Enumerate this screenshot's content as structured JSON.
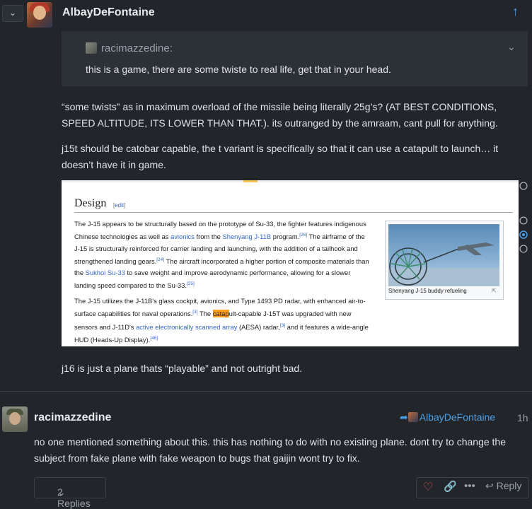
{
  "post1": {
    "username": "AlbayDeFontaine",
    "quote": {
      "username": "racimazzedine:",
      "text": "this is a game, there are some twiste to real life, get that in your head."
    },
    "para1": "“some twists” as in maximum overload of the missile being literally 25g’s? (AT BEST CONDITIONS, SPEED ALTITUDE, ITS LOWER THAN THAT.). its outranged by the amraam, cant pull for anything.",
    "para2": "j15t should be catobar capable, the t variant is specifically so that it can use a catapult to launch… it doesn’t have it in game.",
    "para3": "j16 is just a plane thats “playable” and not outright bad."
  },
  "wiki": {
    "heading": "Design",
    "edit_open": "[",
    "edit_label": "edit",
    "edit_close": "]",
    "caption": "Shenyang J-15 buddy refueling",
    "p1": {
      "a": "The J-15 appears to be structurally based on the prototype of Su-33, the fighter features indigenous Chinese technologies as well as ",
      "link1": "avionics",
      "b": " from the ",
      "link2": "Shenyang J-11B",
      "c": " program.",
      "ref1": "[26]",
      "d": " The airframe of the J-15 is structurally reinforced for carrier landing and launching, with the addition of a tailhook and strengthened landing gears.",
      "ref2": "[24]",
      "e": " The aircraft incorporated a higher portion of composite materials than the ",
      "link3": "Sukhoi Su-33",
      "f": " to save weight and improve aerodynamic performance, allowing for a slower landing speed compared to the Su-33.",
      "ref3": "[25]"
    },
    "p2": {
      "a": "The J-15 utilizes the J-11B's glass cockpit, avionics, and Type 1493 PD radar, with enhanced air-to-surface capabilities for naval operations.",
      "ref1": "[3]",
      "b": " The ",
      "highlight": "catap",
      "c": "ult-capable J-15T was upgraded with new sensors and J-11D's ",
      "link1": "active electronically scanned array",
      "d": " (AESA) radar,",
      "ref2": "[3]",
      "e": " and it features a wide-angle HUD (Heads-Up Display).",
      "ref3": "[46]"
    }
  },
  "post2": {
    "username": "racimazzedine",
    "reply_to": "AlbayDeFontaine",
    "time": "1h",
    "text": "no one mentioned something about this. this has nothing to do with no existing plane. dont try to change the subject from fake plane with fake weapon to bugs that gaijin wont try to fix.",
    "replies_label": "2 Replies",
    "reply_label": "Reply"
  },
  "icons": {
    "collapse": "chevron-down-icon",
    "upvote": "arrow-up-icon",
    "quote_expand": "chevron-down-icon",
    "reply_arrow": "reply-arrow-icon",
    "heart": "heart-icon",
    "link": "link-icon",
    "more": "ellipsis-icon"
  },
  "colors": {
    "background": "#22262b",
    "accent": "#4a9fe8",
    "quote_bg": "#2c3137",
    "highlight": "#ff9d1c",
    "wiki_link": "#3366cc",
    "heart": "#e45757"
  }
}
